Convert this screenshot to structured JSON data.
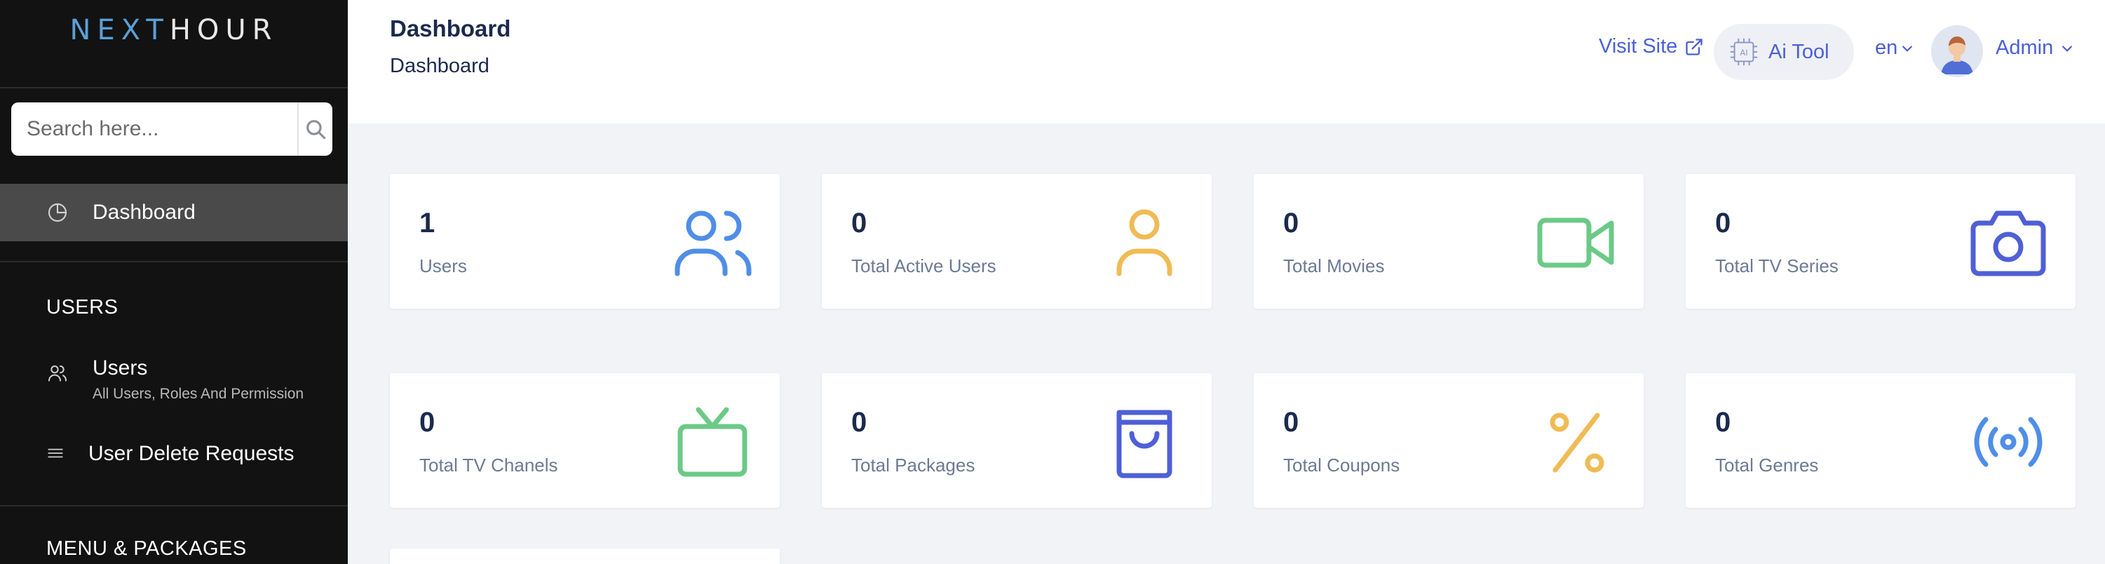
{
  "sidebar": {
    "logo_part1": "NEXT",
    "logo_part2": "HOUR",
    "search_placeholder": "Search here...",
    "active_item": "Dashboard",
    "section_users": "USERS",
    "users_label": "Users",
    "users_sub": "All Users, Roles And Permission",
    "delete_requests_label": "User Delete Requests",
    "section_menu": "MENU & PACKAGES"
  },
  "header": {
    "title": "Dashboard",
    "breadcrumb": "Dashboard",
    "visit_site": "Visit Site",
    "ai_tool": "Ai Tool",
    "ai_chip_text": "AI",
    "language": "en",
    "admin": "Admin"
  },
  "cards": [
    {
      "value": "1",
      "label": "Users",
      "icon": "users-icon",
      "color": "#4f8ee8"
    },
    {
      "value": "0",
      "label": "Total Active Users",
      "icon": "user-icon",
      "color": "#f0bb55"
    },
    {
      "value": "0",
      "label": "Total Movies",
      "icon": "video-camera-icon",
      "color": "#6cc987"
    },
    {
      "value": "0",
      "label": "Total TV Series",
      "icon": "camera-icon",
      "color": "#4f5fd6"
    },
    {
      "value": "0",
      "label": "Total TV Chanels",
      "icon": "tv-icon",
      "color": "#6cc987"
    },
    {
      "value": "0",
      "label": "Total Packages",
      "icon": "shopping-bag-icon",
      "color": "#4f5fd6"
    },
    {
      "value": "0",
      "label": "Total Coupons",
      "icon": "percent-icon",
      "color": "#f0bb55"
    },
    {
      "value": "0",
      "label": "Total Genres",
      "icon": "broadcast-icon",
      "color": "#4f8ee8"
    }
  ],
  "colors": {
    "sidebar_bg": "#121212",
    "accent": "#4a5fd6",
    "page_bg": "#f2f3f7"
  }
}
